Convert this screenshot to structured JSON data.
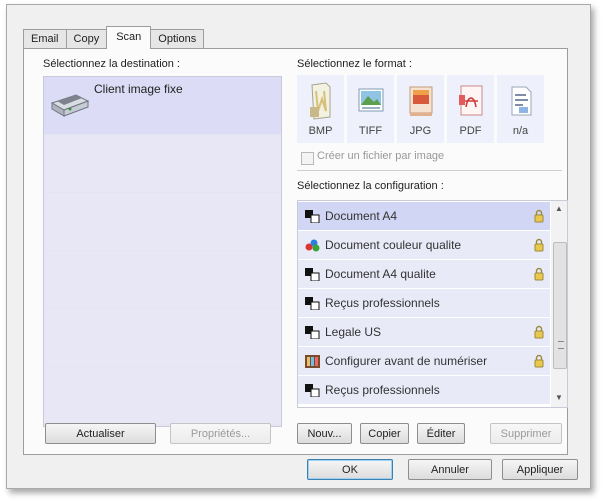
{
  "tabs": [
    {
      "label": "Email"
    },
    {
      "label": "Copy"
    },
    {
      "label": "Scan"
    },
    {
      "label": "Options"
    }
  ],
  "destination": {
    "label": "Sélectionnez la destination :",
    "items": [
      {
        "label": "Client image fixe",
        "icon": "scanner-icon"
      }
    ]
  },
  "format": {
    "label": "Sélectionnez le format :",
    "items": [
      {
        "label": "BMP",
        "icon": "bmp-file-icon"
      },
      {
        "label": "TIFF",
        "icon": "tiff-file-icon"
      },
      {
        "label": "JPG",
        "icon": "jpg-file-icon"
      },
      {
        "label": "PDF",
        "icon": "pdf-file-icon"
      },
      {
        "label": "n/a",
        "icon": "text-file-icon"
      }
    ],
    "checkbox_label": "Créer un fichier par image"
  },
  "configuration": {
    "label": "Sélectionnez la configuration :",
    "items": [
      {
        "label": "Document A4",
        "locked": true
      },
      {
        "label": "Document couleur qualite",
        "locked": true
      },
      {
        "label": "Document A4 qualite",
        "locked": true
      },
      {
        "label": "Reçus professionnels",
        "locked": false
      },
      {
        "label": "Legale US",
        "locked": true
      },
      {
        "label": "Configurer avant de numériser",
        "locked": true
      },
      {
        "label": "Reçus professionnels",
        "locked": false
      }
    ]
  },
  "buttons": {
    "refresh": "Actualiser",
    "properties": "Propriétés...",
    "new": "Nouv...",
    "copy": "Copier",
    "edit": "Éditer",
    "delete": "Supprimer",
    "ok": "OK",
    "cancel": "Annuler",
    "apply": "Appliquer"
  },
  "colors": {
    "selection": "#d2d6f5",
    "list_background": "#e9eaf8",
    "default_button_border": "#3c7fb1"
  }
}
